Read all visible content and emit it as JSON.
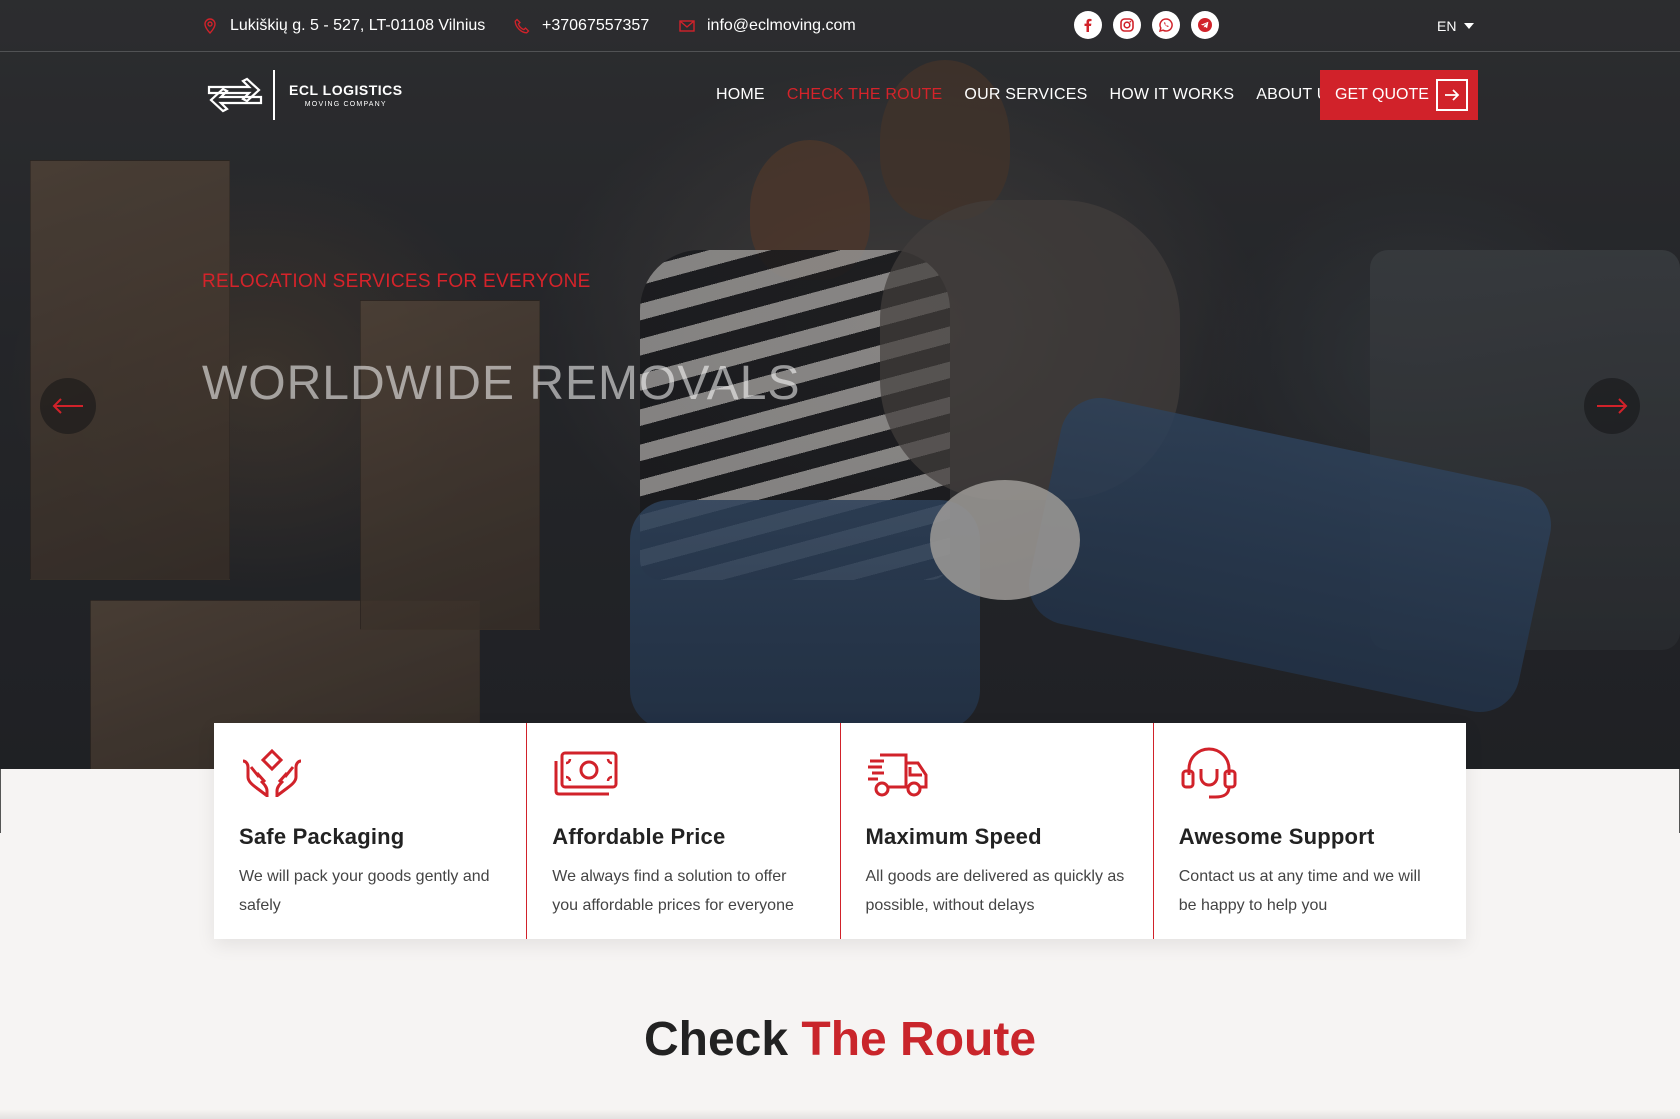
{
  "topbar": {
    "address": "Lukiškių g. 5 - 527, LT-01108 Vilnius",
    "phone": "+37067557357",
    "email": "info@eclmoving.com",
    "language": "EN",
    "socials": [
      "facebook-icon",
      "instagram-icon",
      "whatsapp-icon",
      "telegram-icon"
    ]
  },
  "brand": {
    "name": "ECL LOGISTICS",
    "tagline": "MOVING COMPANY"
  },
  "nav": {
    "items": [
      {
        "label": "HOME",
        "active": false
      },
      {
        "label": "CHECK THE ROUTE",
        "active": true
      },
      {
        "label": "OUR SERVICES",
        "active": false
      },
      {
        "label": "HOW IT WORKS",
        "active": false
      },
      {
        "label": "ABOUT US",
        "active": false
      }
    ],
    "cta": "GET QUOTE"
  },
  "hero": {
    "kicker": "RELOCATION SERVICES FOR EVERYONE",
    "title": "WORLDWIDE REMOVALS"
  },
  "features": [
    {
      "icon": "hands-diamond-icon",
      "title": "Safe Packaging",
      "desc": "We will pack your goods gently and safely"
    },
    {
      "icon": "money-icon",
      "title": "Affordable Price",
      "desc": "We always find a solution to offer you affordable prices for everyone"
    },
    {
      "icon": "truck-icon",
      "title": "Maximum Speed",
      "desc": "All goods are delivered as quickly as possible, without delays"
    },
    {
      "icon": "headset-icon",
      "title": "Awesome Support",
      "desc": "Contact us at any time and we will be happy to help you"
    }
  ],
  "section": {
    "title_plain": "Check",
    "title_accent": "The Route"
  },
  "colors": {
    "accent": "#d1222a",
    "text": "#222222",
    "background": "#f6f4f3"
  }
}
